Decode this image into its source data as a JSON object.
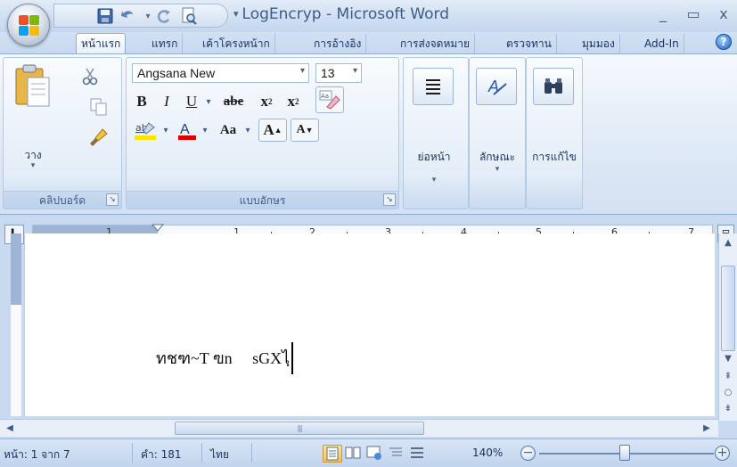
{
  "title_bar": {
    "title": "LogEncryp - Microsoft Word",
    "qat_dropdown_glyph": "▾",
    "controls": {
      "minimize": "_",
      "restore": "▭",
      "close": "x"
    }
  },
  "tabs": [
    {
      "label": "หน้าแรก",
      "active": true
    },
    {
      "label": "แทรก"
    },
    {
      "label": "เค้าโครงหน้าก"
    },
    {
      "label": "การอ้างอิง"
    },
    {
      "label": "การส่งจดหมาย"
    },
    {
      "label": "ตรวจทาน"
    },
    {
      "label": "มุมมอง"
    },
    {
      "label": "Add-In"
    }
  ],
  "help_glyph": "?",
  "ribbon": {
    "clipboard": {
      "label": "คลิปบอร์ด",
      "paste_label": "วาง"
    },
    "font": {
      "label": "แบบอักษร",
      "font_name": "Angsana New",
      "font_size": "13",
      "bold": "B",
      "italic": "I",
      "underline": "U",
      "strike": "abe",
      "subscript": "x",
      "superscript": "x",
      "change_case": "Aa",
      "grow": "A",
      "shrink": "A",
      "clear_label": "Aa"
    },
    "paragraph": {
      "label": "ย่อหน้า"
    },
    "styles": {
      "label": "ลักษณะ"
    },
    "editing": {
      "label": "การแก้ไข"
    }
  },
  "ruler": {
    "tab_selector": "L",
    "numbers": [
      "1",
      "1",
      "2",
      "3",
      "4",
      "5",
      "6",
      "7"
    ]
  },
  "document": {
    "text": "ทชฑ~T ฃn     sGXไฺ"
  },
  "status_bar": {
    "page": "หน้า: 1 จาก 7",
    "words": "คำ: 181",
    "language": "ไทย",
    "zoom": "140%",
    "zoom_level_percent": 140,
    "zoom_out": "−",
    "zoom_in": "+"
  },
  "colors": {
    "ribbon_bg": "#dfe9f6",
    "frame": "#c9d9ef",
    "highlight_yellow": "#ffe600",
    "font_red": "#e00000",
    "accent_text": "#15325e"
  }
}
